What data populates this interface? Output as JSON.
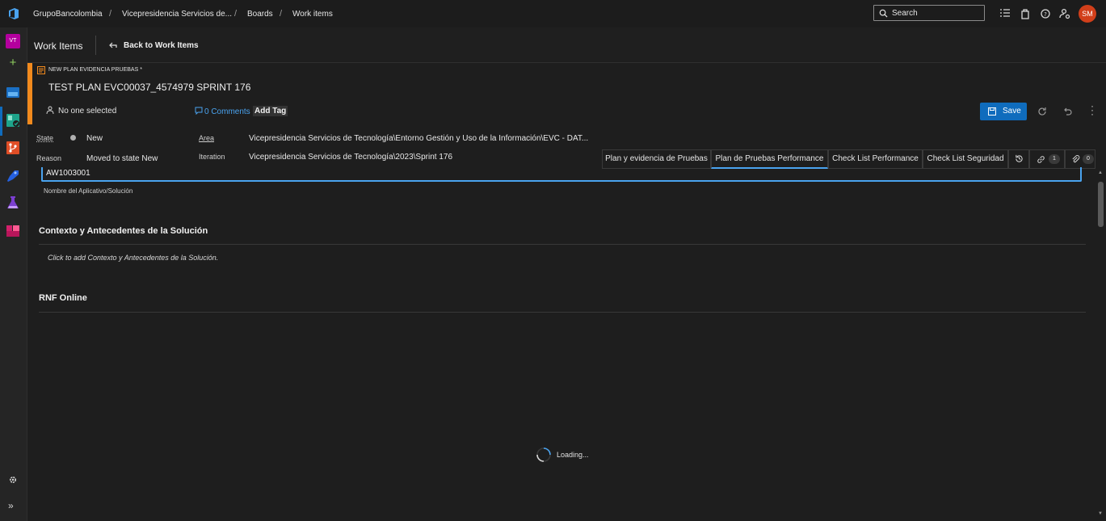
{
  "breadcrumb": {
    "org": "GrupoBancolombia",
    "project": "Vicepresidencia Servicios de...",
    "hub": "Boards",
    "page": "Work items"
  },
  "search": {
    "placeholder": "Search"
  },
  "user": {
    "initials": "SM"
  },
  "rail": {
    "project_initials": "VT"
  },
  "header": {
    "title": "Work Items",
    "back_label": "Back to Work Items"
  },
  "work_item": {
    "type_label": "NEW PLAN EVIDENCIA PRUEBAS *",
    "title": "TEST PLAN EVC00037_4574979 SPRINT 176",
    "assignee": "No one selected",
    "comments": "0 Comments",
    "add_tag": "Add Tag",
    "save_label": "Save"
  },
  "fields": {
    "state_label": "State",
    "state_value": "New",
    "reason_label": "Reason",
    "reason_value": "Moved to state New",
    "area_label": "Area",
    "area_value": "Vicepresidencia Servicios de Tecnología\\Entorno Gestión y Uso de la Información\\EVC - DAT...",
    "iteration_label": "Iteration",
    "iteration_value": "Vicepresidencia Servicios de Tecnología\\2023\\Sprint 176"
  },
  "tabs": [
    {
      "label": "Plan y evidencia de Pruebas"
    },
    {
      "label": "Plan de Pruebas Performance"
    },
    {
      "label": "Check List Performance"
    },
    {
      "label": "Check List Seguridad"
    }
  ],
  "tab_counts": {
    "links": "1",
    "attachments": "0"
  },
  "form": {
    "app_name_value": "AW1003001",
    "app_name_label": "Nombre del Aplicativo/Solución",
    "context_title": "Contexto y Antecedentes de la Solución",
    "context_placeholder": "Click to add Contexto y Antecedentes de la Solución.",
    "rnf_title": "RNF Online",
    "loading": "Loading..."
  },
  "colors": {
    "accent_orange": "#f28a1d",
    "primary_blue": "#0f6cbd",
    "avatar": "#d13f1a",
    "background": "#1e1e1e"
  }
}
